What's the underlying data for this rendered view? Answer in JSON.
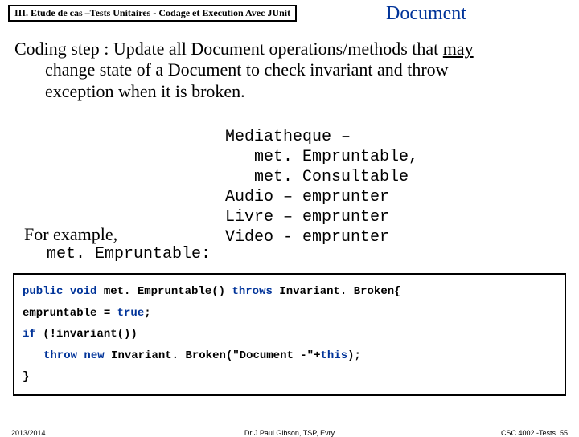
{
  "header": {
    "box": "III. Etude de cas –Tests Unitaires - Codage et Execution Avec JUnit",
    "title": "Document"
  },
  "body": {
    "line1_a": "Coding step : Update all Document operations/methods that ",
    "line1_b": "may",
    "line2": "change state of a Document to check invariant and throw",
    "line3": "exception when it is broken."
  },
  "example": {
    "label": "For example,",
    "labelMono": "met. Empruntable:",
    "classes": "Mediatheque –\n   met. Empruntable,\n   met. Consultable\nAudio – emprunter\nLivre – emprunter\nVideo - emprunter"
  },
  "code": {
    "kw_public": "public",
    "kw_void": "void",
    "sig_mid": " met. Empruntable() ",
    "kw_throws": "throws",
    "sig_end": " Invariant. Broken{",
    "l2a": "empruntable = ",
    "kw_true": "true",
    "l2b": ";",
    "kw_if": "if",
    "l3": " (!invariant())",
    "kw_throw": "throw",
    "kw_new": "new",
    "l4": " Invariant. Broken(\"Document -\"+",
    "kw_this": "this",
    "l4b": ");",
    "l5": "}"
  },
  "footer": {
    "left": "2013/2014",
    "center": "Dr J Paul Gibson, TSP, Evry",
    "right": "CSC 4002 -Tests. 55"
  }
}
